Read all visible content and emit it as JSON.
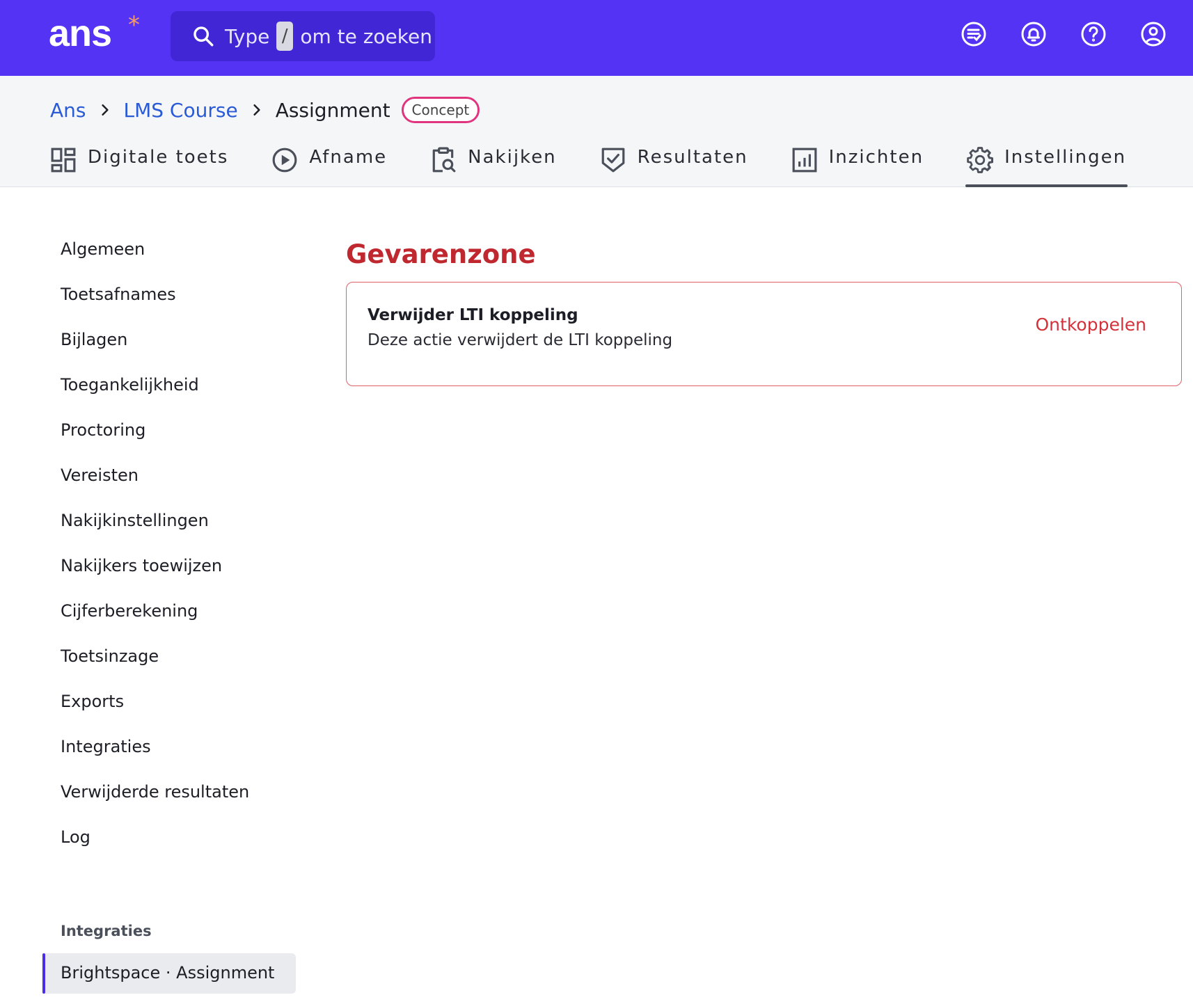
{
  "app": {
    "logo_text": "ans",
    "logo_mark": "*",
    "search": {
      "prefix": "Type",
      "key": "/",
      "suffix": "om te zoeken"
    },
    "top_icons": [
      "checklist-icon",
      "bell-icon",
      "help-icon",
      "account-icon"
    ]
  },
  "breadcrumb": {
    "items": [
      "Ans",
      "LMS Course"
    ],
    "current": "Assignment",
    "badge": "Concept"
  },
  "tabs": [
    {
      "label": "Digitale toets",
      "icon": "dashboard-icon"
    },
    {
      "label": "Afname",
      "icon": "play-circle-icon"
    },
    {
      "label": "Nakijken",
      "icon": "clipboard-search-icon"
    },
    {
      "label": "Resultaten",
      "icon": "shield-check-icon"
    },
    {
      "label": "Inzichten",
      "icon": "bar-chart-icon"
    },
    {
      "label": "Instellingen",
      "icon": "gear-icon",
      "active": true
    }
  ],
  "sidebar": {
    "items": [
      "Algemeen",
      "Toetsafnames",
      "Bijlagen",
      "Toegankelijkheid",
      "Proctoring",
      "Vereisten",
      "Nakijkinstellingen",
      "Nakijkers toewijzen",
      "Cijferberekening",
      "Toetsinzage",
      "Exports",
      "Integraties",
      "Verwijderde resultaten",
      "Log"
    ],
    "section_heading": "Integraties",
    "active_item": "Brightspace · Assignment"
  },
  "main": {
    "title": "Gevarenzone",
    "card": {
      "title": "Verwijder LTI koppeling",
      "description": "Deze actie verwijdert de LTI koppeling",
      "action": "Ontkoppelen"
    }
  },
  "colors": {
    "topbar": "#5533f5",
    "danger": "#c0282f",
    "link": "#2a5bd7",
    "badge_border": "#e0347f"
  }
}
